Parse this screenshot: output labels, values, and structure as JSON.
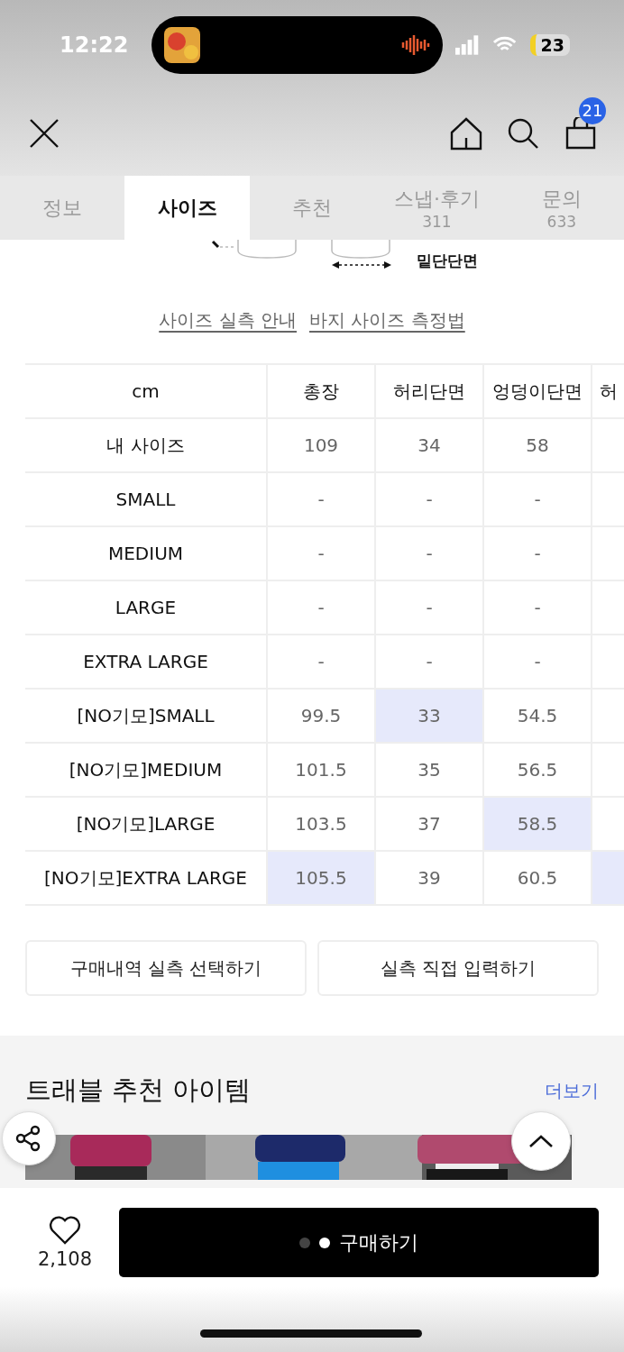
{
  "status_bar": {
    "time": "12:22",
    "battery": "23"
  },
  "nav": {
    "cart_count": "21"
  },
  "tabs": [
    {
      "label": "정보",
      "selected": false
    },
    {
      "label": "사이즈",
      "selected": true
    },
    {
      "label": "추천",
      "selected": false
    },
    {
      "label": "스냅·후기",
      "count": "311",
      "selected": false
    },
    {
      "label": "문의",
      "count": "633",
      "selected": false
    }
  ],
  "diagram": {
    "label": "밑단단면"
  },
  "links": [
    "사이즈 실측 안내",
    "바지 사이즈 측정법"
  ],
  "size_table": {
    "columns": [
      "cm",
      "총장",
      "허리단면",
      "엉덩이단면",
      "허"
    ],
    "rows": [
      {
        "cells": [
          {
            "value": "내 사이즈",
            "highlighted": false
          },
          {
            "value": "109",
            "highlighted": false
          },
          {
            "value": "34",
            "highlighted": false
          },
          {
            "value": "58",
            "highlighted": false
          },
          {
            "highlighted": false
          }
        ]
      },
      {
        "cells": [
          {
            "value": "SMALL",
            "highlighted": false
          },
          {
            "value": "-",
            "highlighted": false
          },
          {
            "value": "-",
            "highlighted": false
          },
          {
            "value": "-",
            "highlighted": false
          },
          {
            "highlighted": false
          }
        ]
      },
      {
        "cells": [
          {
            "value": "MEDIUM",
            "highlighted": false
          },
          {
            "value": "-",
            "highlighted": false
          },
          {
            "value": "-",
            "highlighted": false
          },
          {
            "value": "-",
            "highlighted": false
          },
          {
            "highlighted": false
          }
        ]
      },
      {
        "cells": [
          {
            "value": "LARGE",
            "highlighted": false
          },
          {
            "value": "-",
            "highlighted": false
          },
          {
            "value": "-",
            "highlighted": false
          },
          {
            "value": "-",
            "highlighted": false
          },
          {
            "highlighted": false
          }
        ]
      },
      {
        "cells": [
          {
            "value": "EXTRA LARGE",
            "highlighted": false
          },
          {
            "value": "-",
            "highlighted": false
          },
          {
            "value": "-",
            "highlighted": false
          },
          {
            "value": "-",
            "highlighted": false
          },
          {
            "highlighted": false
          }
        ]
      },
      {
        "cells": [
          {
            "value": "[NO기모]SMALL",
            "highlighted": false
          },
          {
            "value": "99.5",
            "highlighted": false
          },
          {
            "value": "33",
            "highlighted": true
          },
          {
            "value": "54.5",
            "highlighted": false
          },
          {
            "highlighted": false
          }
        ]
      },
      {
        "cells": [
          {
            "value": "[NO기모]MEDIUM",
            "highlighted": false
          },
          {
            "value": "101.5",
            "highlighted": false
          },
          {
            "value": "35",
            "highlighted": false
          },
          {
            "value": "56.5",
            "highlighted": false
          },
          {
            "highlighted": false
          }
        ]
      },
      {
        "cells": [
          {
            "value": "[NO기모]LARGE",
            "highlighted": false
          },
          {
            "value": "103.5",
            "highlighted": false
          },
          {
            "value": "37",
            "highlighted": false
          },
          {
            "value": "58.5",
            "highlighted": true
          },
          {
            "highlighted": false
          }
        ]
      },
      {
        "cells": [
          {
            "value": "[NO기모]EXTRA LARGE",
            "highlighted": false
          },
          {
            "value": "105.5",
            "highlighted": true
          },
          {
            "value": "39",
            "highlighted": false
          },
          {
            "value": "60.5",
            "highlighted": false
          },
          {
            "highlighted": true
          }
        ]
      }
    ]
  },
  "actions": [
    "구매내역 실측 선택하기",
    "실측 직접 입력하기"
  ],
  "recommend": {
    "title": "트래블 추천 아이템",
    "more": "더보기"
  },
  "bottom_bar": {
    "likes": "2,108",
    "buy": "구매하기"
  }
}
